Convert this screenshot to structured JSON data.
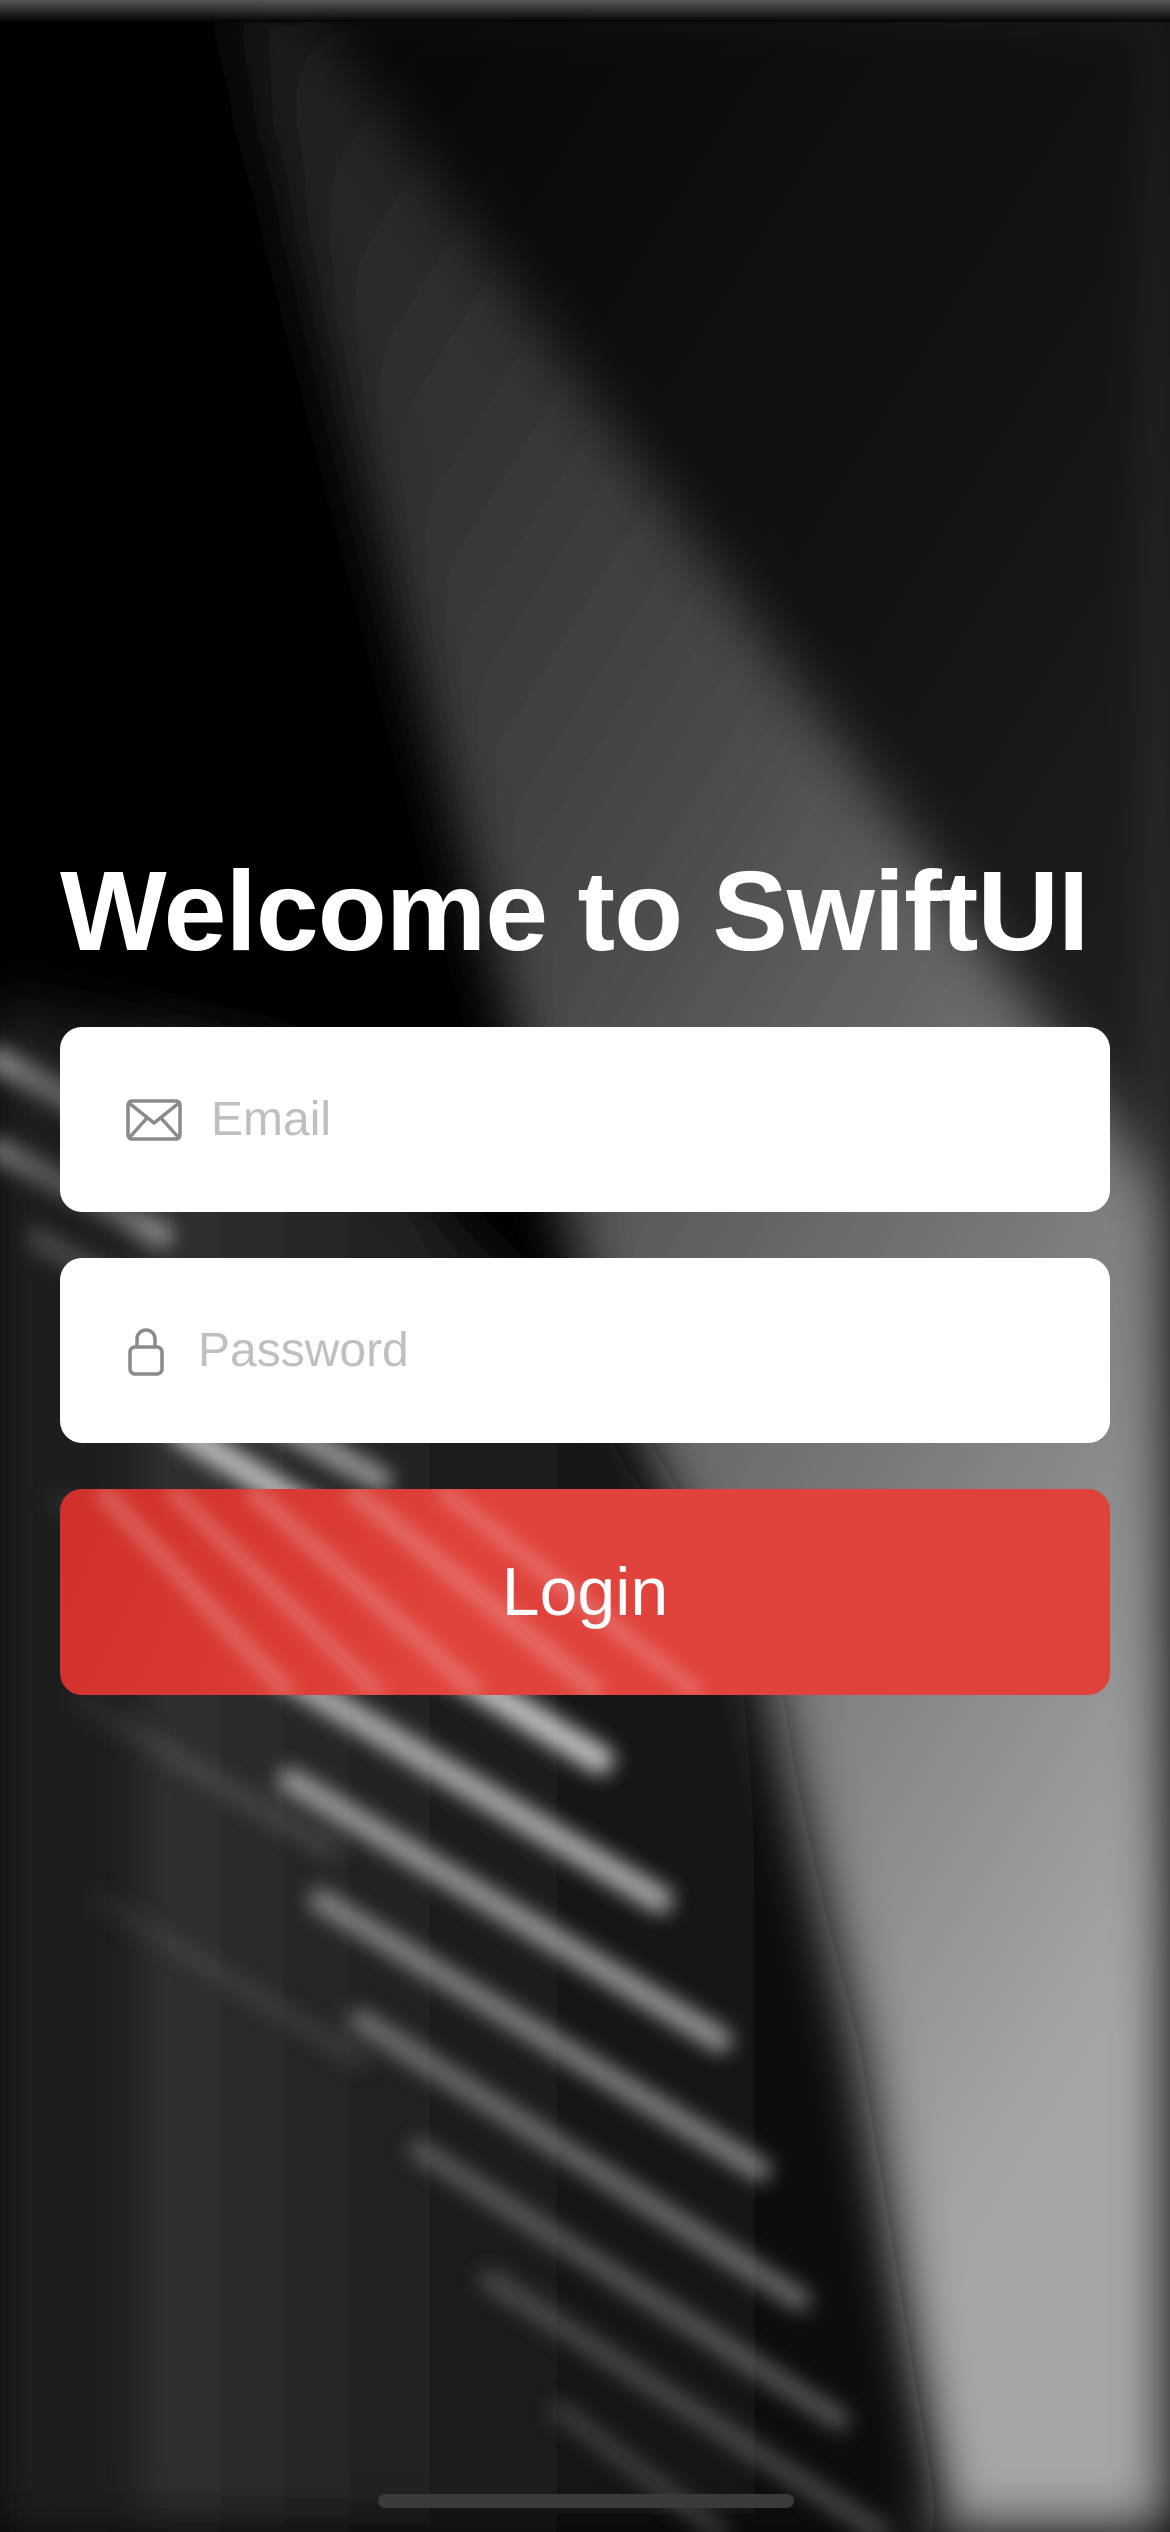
{
  "app": {
    "title": "Welcome to SwiftUI"
  },
  "form": {
    "email": {
      "placeholder": "Email",
      "value": "",
      "icon": "envelope-icon"
    },
    "password": {
      "placeholder": "Password",
      "value": "",
      "icon": "lock-icon"
    },
    "login_label": "Login"
  },
  "colors": {
    "accent": "#df413b",
    "field_background": "#ffffff",
    "placeholder": "#bfbfbf",
    "icon": "#8a8a8a"
  }
}
